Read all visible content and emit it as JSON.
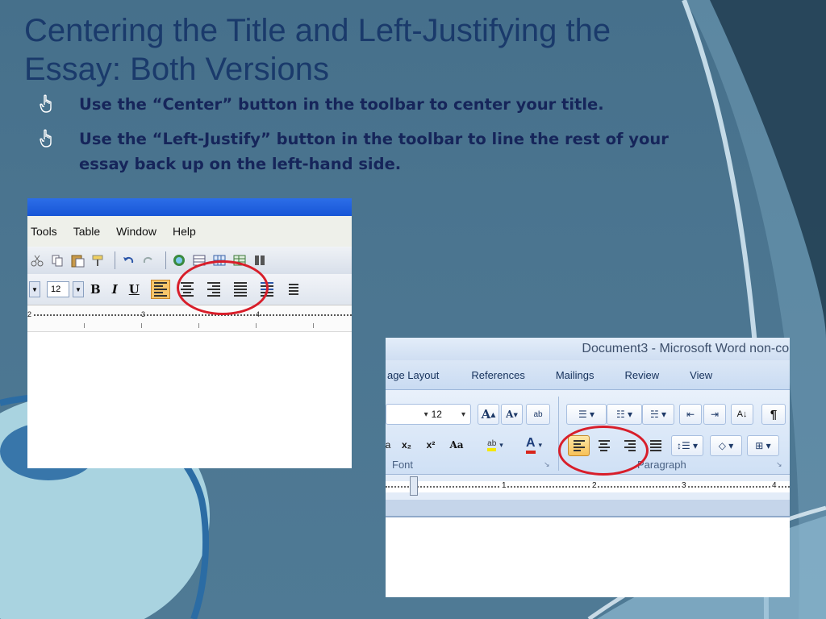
{
  "slide": {
    "title": "Centering the Title and Left-Justifying the Essay: Both Versions",
    "bullets": [
      "Use the “Center” button in the toolbar to center your title.",
      "Use the “Left-Justify” button in the toolbar to line the rest of your essay back up on the left-hand side."
    ],
    "colors": {
      "background": "#4b7590",
      "title": "#1a3a6b",
      "bullet_text": "#16255a",
      "highlight_circle": "#d81e2a"
    }
  },
  "word2003": {
    "menu": [
      "Tools",
      "Table",
      "Window",
      "Help"
    ],
    "font_size": "12",
    "bold": "B",
    "italic": "I",
    "underline": "U",
    "ruler_marks": [
      "2",
      "3",
      "4"
    ],
    "selected_button": "align-left-icon"
  },
  "word2007": {
    "window_title": "Document3 - Microsoft Word non-con",
    "tabs": [
      "age Layout",
      "References",
      "Mailings",
      "Review",
      "View"
    ],
    "font_size": "12",
    "group_font": "Font",
    "group_paragraph": "Paragraph",
    "ruler_marks": [
      "1",
      "2",
      "3",
      "4"
    ],
    "subscript": "x₂",
    "superscript": "x²",
    "change_case": "Aa",
    "grow_font": "A",
    "shrink_font": "A",
    "highlight": "ab",
    "font_color": "A",
    "selected_button": "align-left-icon"
  }
}
